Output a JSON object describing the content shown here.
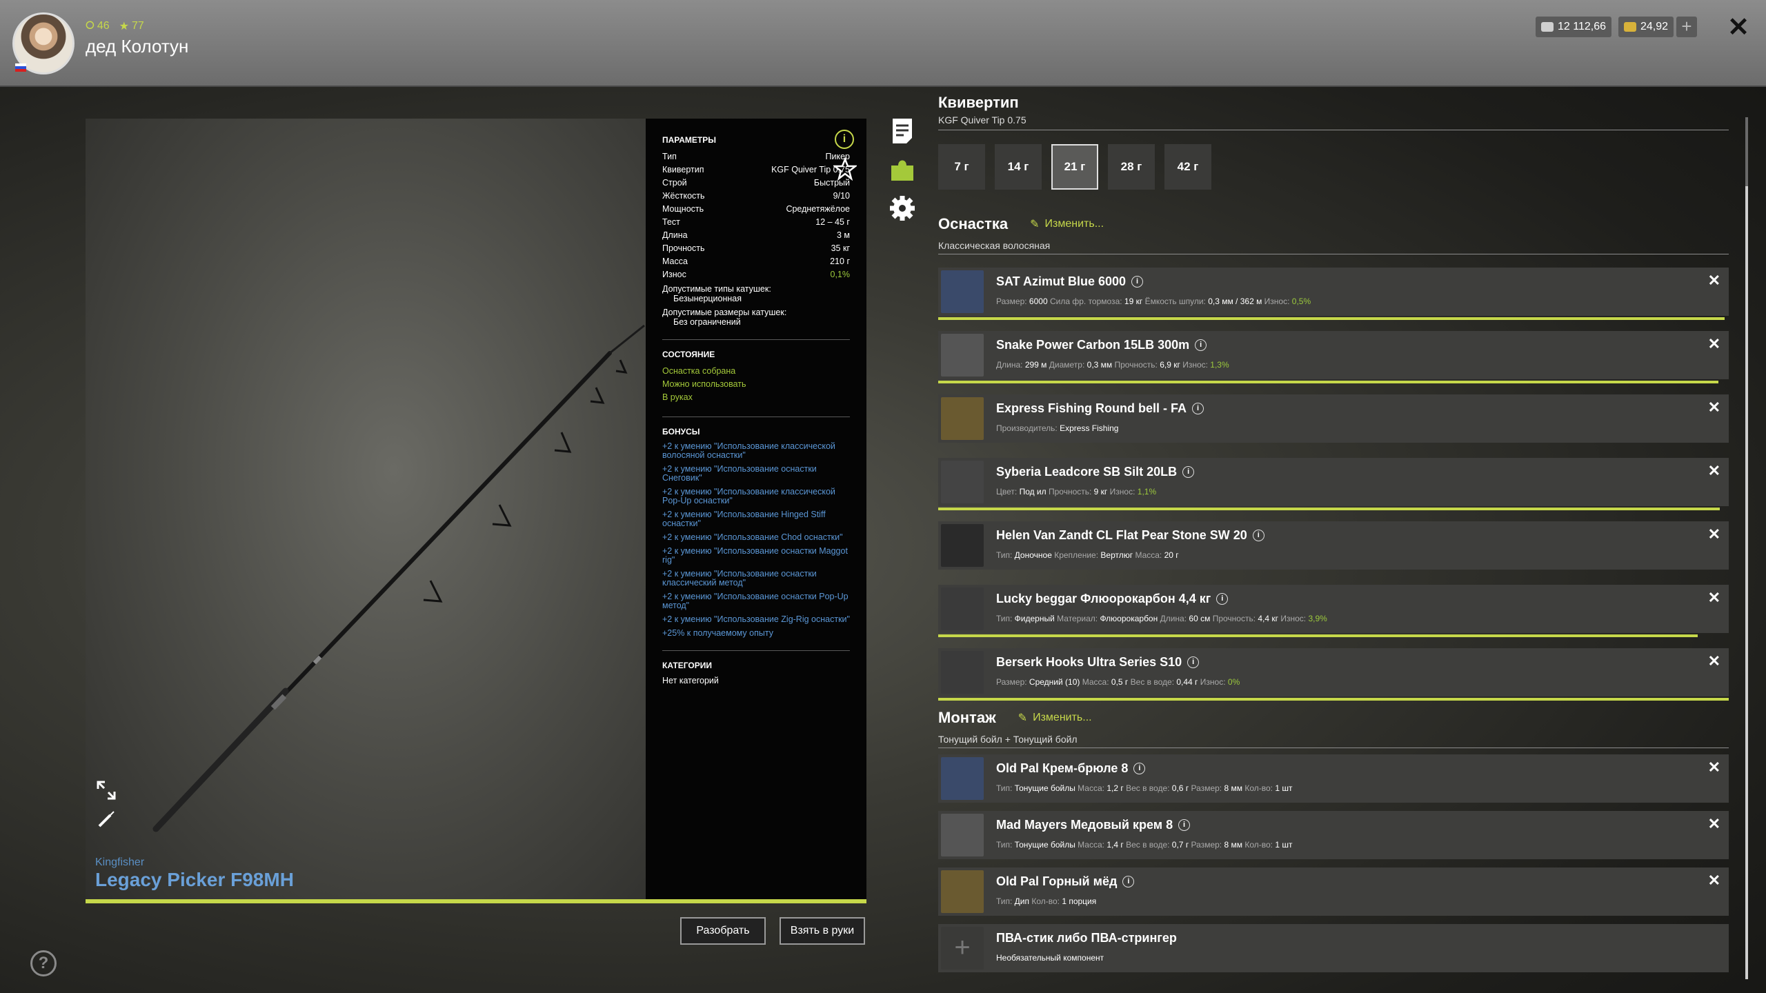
{
  "player": {
    "name": "дед Колотун",
    "stat1": "46",
    "stat2": "77"
  },
  "currency": {
    "silver": "12 112,66",
    "gold": "24,92"
  },
  "rod": {
    "brand": "Kingfisher",
    "name": "Legacy Picker F98MH"
  },
  "params": {
    "title": "ПАРАМЕТРЫ",
    "rows": [
      {
        "k": "Тип",
        "v": "Пикер"
      },
      {
        "k": "Квивертип",
        "v": "KGF Quiver Tip 0.75"
      },
      {
        "k": "Строй",
        "v": "Быстрый"
      },
      {
        "k": "Жёсткость",
        "v": "9/10"
      },
      {
        "k": "Мощность",
        "v": "Среднетяжёлое"
      },
      {
        "k": "Тест",
        "v": "12 – 45 г"
      },
      {
        "k": "Длина",
        "v": "3 м"
      },
      {
        "k": "Прочность",
        "v": "35 кг"
      },
      {
        "k": "Масса",
        "v": "210 г"
      },
      {
        "k": "Износ",
        "v": "0,1%"
      }
    ],
    "reel_types_label": "Допустимые типы катушек:",
    "reel_types_value": "Безынерционная",
    "reel_sizes_label": "Допустимые размеры катушек:",
    "reel_sizes_value": "Без ограничений",
    "state_title": "СОСТОЯНИЕ",
    "state": [
      "Оснастка собрана",
      "Можно использовать",
      "В руках"
    ],
    "bonus_title": "БОНУСЫ",
    "bonuses": [
      "+2 к умению \"Использование классической волосяной оснастки\"",
      "+2 к умению \"Использование оснастки Снеговик\"",
      "+2 к умению \"Использование классической Pop-Up оснастки\"",
      "+2 к умению \"Использование Hinged Stiff оснастки\"",
      "+2 к умению \"Использование Chod оснастки\"",
      "+2 к умению \"Использование оснастки Maggot rig\"",
      "+2 к умению \"Использование оснастки классический метод\"",
      "+2 к умению \"Использование оснастки Pop-Up метод\"",
      "+2 к умению \"Использование Zig-Rig оснастки\"",
      "+25% к получаемому опыту"
    ],
    "cat_title": "КАТЕГОРИИ",
    "cat_value": "Нет категорий"
  },
  "buttons": {
    "disassemble": "Разобрать",
    "take": "Взять в руки"
  },
  "quiver": {
    "title": "Квивертип",
    "subtitle": "KGF Quiver Tip 0.75",
    "tabs": [
      "7 г",
      "14 г",
      "21 г",
      "28 г",
      "42 г"
    ],
    "active_tab": "21 г"
  },
  "tackle": {
    "title": "Оснастка",
    "edit": "Изменить...",
    "subtitle": "Классическая волосяная",
    "items": [
      {
        "name": "SAT Azimut Blue 6000",
        "details": [
          [
            "Размер:",
            "6000"
          ],
          [
            "Сила фр. тормоза:",
            "19 кг"
          ],
          [
            "Ёмкость шпули:",
            "0,3 мм / 362 м"
          ],
          [
            "Износ:",
            "0,5%"
          ]
        ],
        "wear": 0.995,
        "removable": true
      },
      {
        "name": "Snake Power Carbon 15LB 300m",
        "details": [
          [
            "Длина:",
            "299 м"
          ],
          [
            "Диаметр:",
            "0,3 мм"
          ],
          [
            "Прочность:",
            "6,9 кг"
          ],
          [
            "Износ:",
            "1,3%"
          ]
        ],
        "wear": 0.987,
        "removable": true
      },
      {
        "name": "Express Fishing Round bell - FA",
        "details": [
          [
            "Производитель:",
            "Express Fishing"
          ]
        ],
        "wear": null,
        "removable": true
      },
      {
        "name": "Syberia Leadcore SB Silt 20LB",
        "details": [
          [
            "Цвет:",
            "Под ил"
          ],
          [
            "Прочность:",
            "9 кг"
          ],
          [
            "Износ:",
            "1,1%"
          ]
        ],
        "wear": 0.989,
        "removable": true
      },
      {
        "name": "Helen Van Zandt CL Flat Pear Stone SW 20",
        "details": [
          [
            "Тип:",
            "Доночное"
          ],
          [
            "Крепление:",
            "Вертлюг"
          ],
          [
            "Масса:",
            "20 г"
          ]
        ],
        "wear": null,
        "removable": true
      },
      {
        "name": "Lucky beggar Флюорокарбон 4,4 кг",
        "details": [
          [
            "Тип:",
            "Фидерный"
          ],
          [
            "Материал:",
            "Флюорокарбон"
          ],
          [
            "Длина:",
            "60 см"
          ],
          [
            "Прочность:",
            "4,4 кг"
          ],
          [
            "Износ:",
            "3,9%"
          ]
        ],
        "wear": 0.961,
        "removable": true
      },
      {
        "name": "Berserk Hooks Ultra Series S10",
        "details": [
          [
            "Размер:",
            "Средний (10)"
          ],
          [
            "Масса:",
            "0,5 г"
          ],
          [
            "Вес в воде:",
            "0,44 г"
          ],
          [
            "Износ:",
            "0%"
          ]
        ],
        "wear": 1.0,
        "removable": true
      }
    ]
  },
  "montage": {
    "title": "Монтаж",
    "edit": "Изменить...",
    "subtitle": "Тонущий бойл + Тонущий бойл",
    "items": [
      {
        "name": "Old Pal Крем-брюле 8",
        "details": [
          [
            "Тип:",
            "Тонущие бойлы"
          ],
          [
            "Масса:",
            "1,2 г"
          ],
          [
            "Вес в воде:",
            "0,6 г"
          ],
          [
            "Размер:",
            "8 мм"
          ],
          [
            "Кол-во:",
            "1 шт"
          ]
        ],
        "removable": true
      },
      {
        "name": "Mad Mayers Медовый крем 8",
        "details": [
          [
            "Тип:",
            "Тонущие бойлы"
          ],
          [
            "Масса:",
            "1,4 г"
          ],
          [
            "Вес в воде:",
            "0,7 г"
          ],
          [
            "Размер:",
            "8 мм"
          ],
          [
            "Кол-во:",
            "1 шт"
          ]
        ],
        "removable": true
      },
      {
        "name": "Old Pal Горный мёд",
        "details": [
          [
            "Тип:",
            "Дип"
          ],
          [
            "Кол-во:",
            "1 порция"
          ]
        ],
        "removable": true
      },
      {
        "name": "ПВА-стик либо ПВА-стрингер",
        "details": [
          [
            "",
            "Необязательный компонент"
          ]
        ],
        "removable": false
      }
    ]
  },
  "colors": {
    "accent": "#c6d84a",
    "link": "#5b97d6",
    "rodname": "#6aa0d8"
  }
}
